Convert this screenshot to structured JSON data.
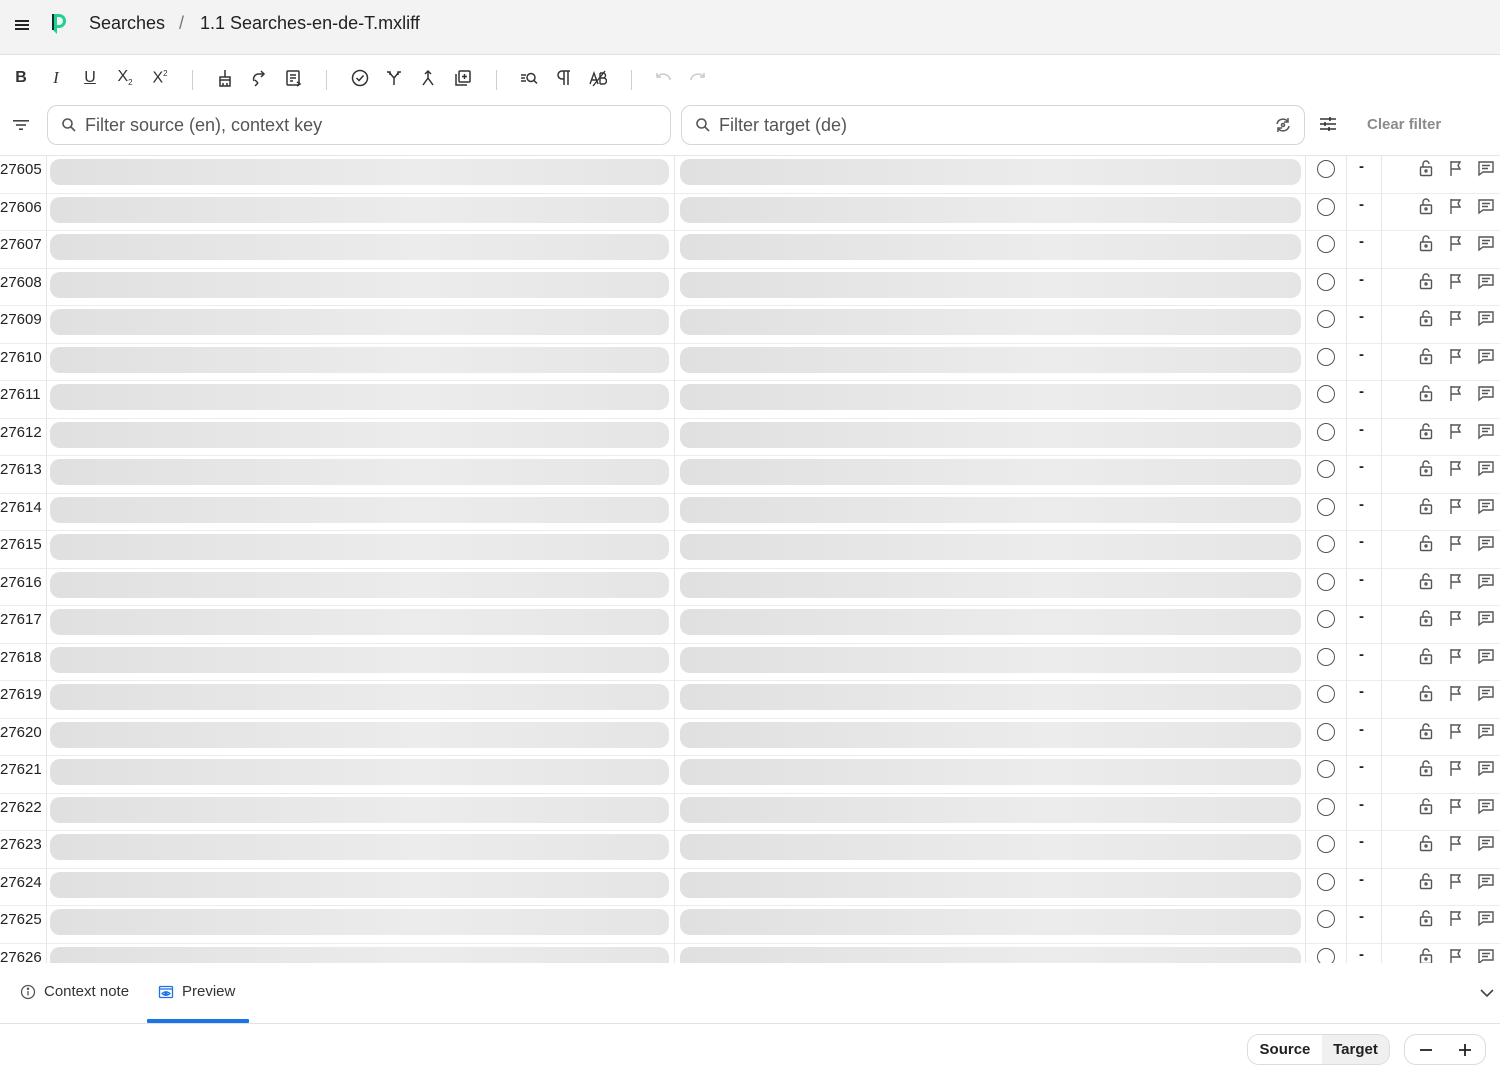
{
  "header": {
    "crumb_project": "Searches",
    "crumb_separator": "/",
    "crumb_file": "1.1 Searches-en-de-T.mxliff"
  },
  "toolbar": {
    "bold": "B",
    "italic": "I",
    "underline": "U",
    "subscript": "X",
    "subscript_mark": "2",
    "superscript": "X",
    "superscript_mark": "2",
    "icons": [
      "bold-icon",
      "italic-icon",
      "underline-icon",
      "subscript-icon",
      "superscript-icon",
      "clear-formatting-icon",
      "copy-source-icon",
      "insert-tags-icon",
      "confirm-icon",
      "split-icon",
      "join-icon",
      "add-segment-icon",
      "find-replace-icon",
      "pilcrow-icon",
      "spellcheck-icon",
      "undo-icon",
      "redo-icon"
    ]
  },
  "filters": {
    "source_placeholder": "Filter source (en), context key",
    "target_placeholder": "Filter target (de)",
    "clear_label": "Clear filter"
  },
  "rows": [
    {
      "num": "27605"
    },
    {
      "num": "27606"
    },
    {
      "num": "27607"
    },
    {
      "num": "27608"
    },
    {
      "num": "27609"
    },
    {
      "num": "27610"
    },
    {
      "num": "27611"
    },
    {
      "num": "27612"
    },
    {
      "num": "27613"
    },
    {
      "num": "27614"
    },
    {
      "num": "27615"
    },
    {
      "num": "27616"
    },
    {
      "num": "27617"
    },
    {
      "num": "27618"
    },
    {
      "num": "27619"
    },
    {
      "num": "27620"
    },
    {
      "num": "27621"
    },
    {
      "num": "27622"
    },
    {
      "num": "27623"
    },
    {
      "num": "27624"
    },
    {
      "num": "27625"
    },
    {
      "num": "27626"
    }
  ],
  "row_match_value": "-",
  "bottom": {
    "tab_context_note": "Context note",
    "tab_preview": "Preview",
    "active_tab": "Preview",
    "seg_source": "Source",
    "seg_target": "Target"
  },
  "colors": {
    "accent": "#1a73e8",
    "logo": "#1fd190",
    "header_bg": "#f3f3f3"
  }
}
